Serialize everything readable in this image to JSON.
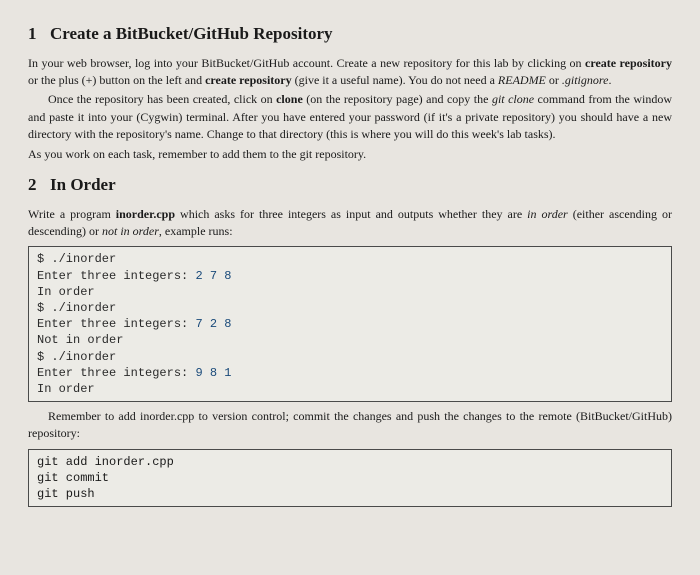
{
  "s1": {
    "num": "1",
    "title": "Create a BitBucket/GitHub Repository",
    "p1a": "In your web browser, log into your BitBucket/GitHub account. Create a new repository for this lab by clicking on ",
    "p1b_bold": "create repository",
    "p1c": " or the plus (+) button on the left and ",
    "p1d_bold": "create repository",
    "p1e": " (give it a useful name). You do not need a ",
    "p1f_it": "README",
    "p1g": " or ",
    "p1h_it": ".gitignore",
    "p1i": ".",
    "p2a": "Once the repository has been created, click on ",
    "p2b_bold": "clone",
    "p2c": " (on the repository page) and copy the ",
    "p2d_it": "git clone",
    "p2e": " command from the window and paste it into your (Cygwin) terminal. After you have entered your password (if it's a private repository) you should have a new directory with the repository's name. Change to that directory (this is where you will do this week's lab tasks).",
    "p3": "As you work on each task, remember to add them to the git repository."
  },
  "s2": {
    "num": "2",
    "title": "In Order",
    "p1a": "Write a program ",
    "p1b_bold": "inorder.cpp",
    "p1c": " which asks for three integers as input and outputs whether they are ",
    "p1d_it": "in order",
    "p1e": " (either ascending or descending) or ",
    "p1f_it": "not in order",
    "p1g": ", example runs:",
    "code1": {
      "l1": "$ ./inorder",
      "l2a": "Enter three integers: ",
      "l2b": "2 7 8",
      "l3": "In order",
      "l4": "$ ./inorder",
      "l5a": "Enter three integers: ",
      "l5b": "7 2 8",
      "l6": "Not in order",
      "l7": "$ ./inorder",
      "l8a": "Enter three integers: ",
      "l8b": "9 8 1",
      "l9": "In order"
    },
    "p2": "Remember to add inorder.cpp to version control; commit the changes and push the changes to the remote (BitBucket/GitHub) repository:",
    "code2": {
      "l1": "git add inorder.cpp",
      "l2": "git commit",
      "l3": "git push"
    }
  }
}
